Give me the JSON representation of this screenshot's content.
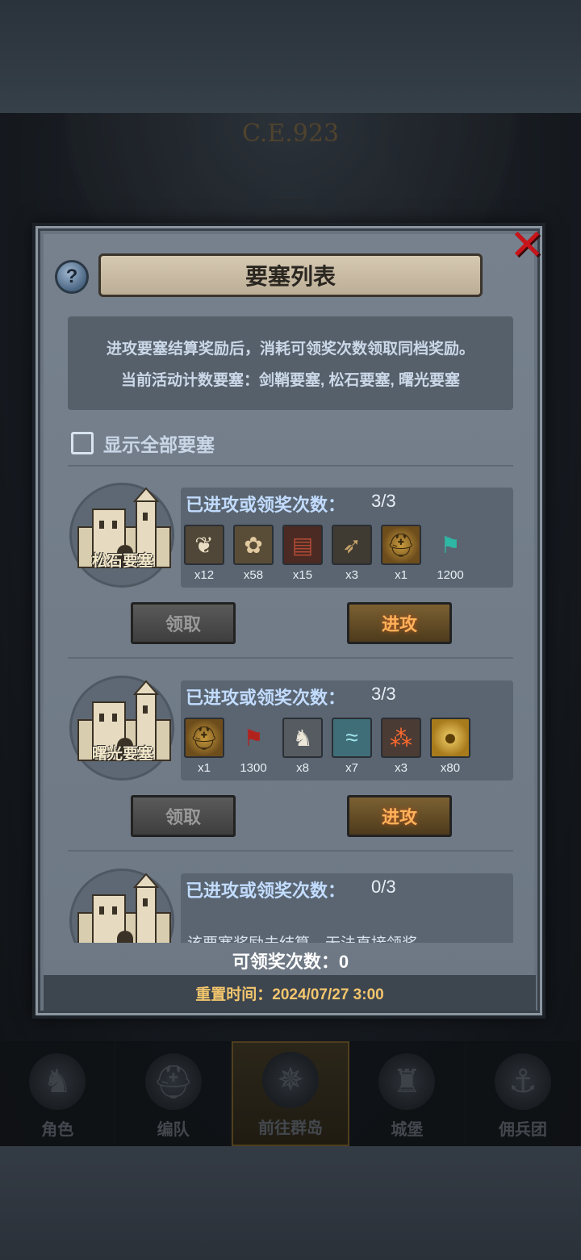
{
  "background": {
    "era": "C.E.923"
  },
  "bottom_nav": [
    {
      "label": "角色",
      "icon": "knight-icon"
    },
    {
      "label": "编队",
      "icon": "helmet-icon"
    },
    {
      "label": "前往群岛",
      "icon": "compass-icon",
      "active": true
    },
    {
      "label": "城堡",
      "icon": "castle-icon"
    },
    {
      "label": "佣兵团",
      "icon": "ship-icon"
    }
  ],
  "modal": {
    "title": "要塞列表",
    "description_line1": "进攻要塞结算奖励后，消耗可领奖次数领取同档奖励。",
    "description_line2": "当前活动计数要塞：剑鞘要塞, 松石要塞, 曙光要塞",
    "show_all_label": "显示全部要塞",
    "show_all_checked": false,
    "fortresses": [
      {
        "name": "松石要塞",
        "count_label": "已进攻或领奖次数：",
        "count_value": "3/3",
        "rewards": [
          {
            "icon": "fur-icon",
            "qty": "x12"
          },
          {
            "icon": "hide-icon",
            "qty": "x58"
          },
          {
            "icon": "wood-icon",
            "qty": "x15"
          },
          {
            "icon": "horn-icon",
            "qty": "x3"
          },
          {
            "icon": "helmet-token-icon",
            "qty": "x1"
          },
          {
            "icon": "banner-icon",
            "qty": "1200"
          }
        ],
        "claim_label": "领取",
        "attack_label": "进攻"
      },
      {
        "name": "曙光要塞",
        "count_label": "已进攻或领奖次数：",
        "count_value": "3/3",
        "rewards": [
          {
            "icon": "helmet-token-icon",
            "qty": "x1"
          },
          {
            "icon": "red-banner-icon",
            "qty": "1300"
          },
          {
            "icon": "horse-icon",
            "qty": "x8"
          },
          {
            "icon": "cloth-icon",
            "qty": "x7"
          },
          {
            "icon": "roe-icon",
            "qty": "x3"
          },
          {
            "icon": "gold-coin-icon",
            "qty": "x80"
          }
        ],
        "claim_label": "领取",
        "attack_label": "进攻"
      },
      {
        "name": "",
        "count_label": "已进攻或领奖次数：",
        "count_value": "0/3",
        "note": "该要塞奖励未结算，无法直接领奖。"
      }
    ],
    "claimable_label": "可领奖次数：0",
    "reset_label": "重置时间：2024/07/27 3:00"
  },
  "colors": {
    "accent_gold": "#f3c66d",
    "attack_orange": "#ffb15a",
    "count_blue": "#c2dcff",
    "close_red": "#c7151b"
  }
}
